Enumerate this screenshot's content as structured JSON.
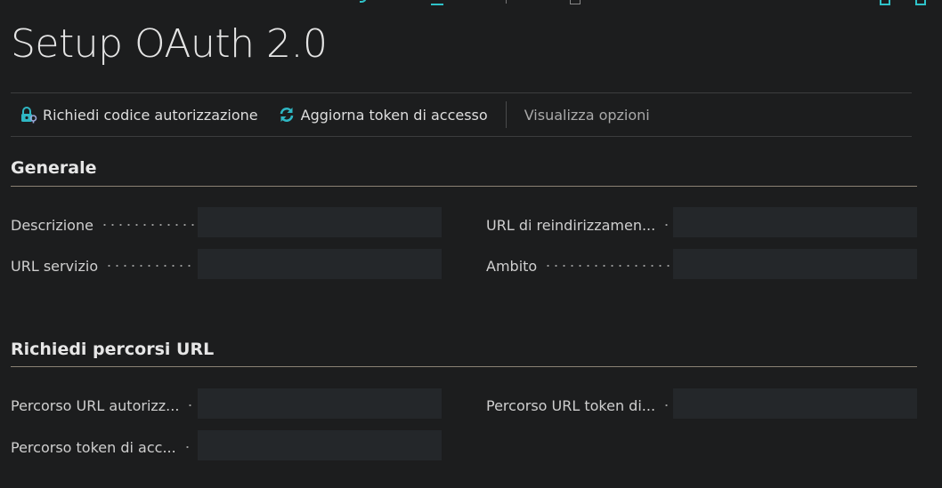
{
  "page": {
    "title": "Setup OAuth 2.0"
  },
  "toolbar": {
    "request_code_label": "Richiedi codice autorizzazione",
    "refresh_token_label": "Aggiorna token di accesso",
    "view_options_label": "Visualizza opzioni"
  },
  "sections": {
    "general": {
      "title": "Generale",
      "description_label": "Descrizione",
      "description_value": "",
      "service_url_label": "URL servizio",
      "service_url_value": "",
      "redirect_url_label": "URL di reindirizzamen...",
      "redirect_url_value": "",
      "scope_label": "Ambito",
      "scope_value": ""
    },
    "url_paths": {
      "title": "Richiedi percorsi URL",
      "auth_url_path_label": "Percorso URL autorizz...",
      "auth_url_path_value": "",
      "token_url_path_label": "Percorso URL token di...",
      "token_url_path_value": "",
      "access_token_path_label": "Percorso token di acc...",
      "access_token_path_value": ""
    }
  },
  "colors": {
    "background": "#1c1d1e",
    "accent": "#2fc3c9",
    "input_bg": "#24272a",
    "section_rule": "#8b8274"
  }
}
